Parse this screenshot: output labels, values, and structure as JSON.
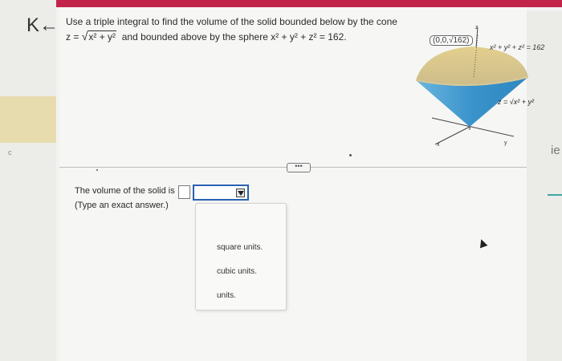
{
  "nav": {
    "back_glyph": "K←"
  },
  "question": {
    "line1": "Use a triple integral to find the volume of the solid bounded below by the cone",
    "cone_prefix": "z =",
    "cone_radicand": "x² + y²",
    "line2_mid": "and bounded above by the sphere x² + y² + z² = 162."
  },
  "figure": {
    "point_label": "(0,0,√162)",
    "sphere_label": "x² + y² + z² = 162",
    "cone_label": "z = √x² + y²",
    "z_axis": "z",
    "x_axis": "x",
    "y_axis": "y"
  },
  "expand_label": "•••",
  "answer": {
    "prompt": "The volume of the solid is",
    "hint": "(Type an exact answer.)",
    "value": "",
    "unit_selected": "",
    "unit_options": [
      "square units.",
      "cubic units.",
      "units."
    ]
  },
  "right_fragment": "ie"
}
